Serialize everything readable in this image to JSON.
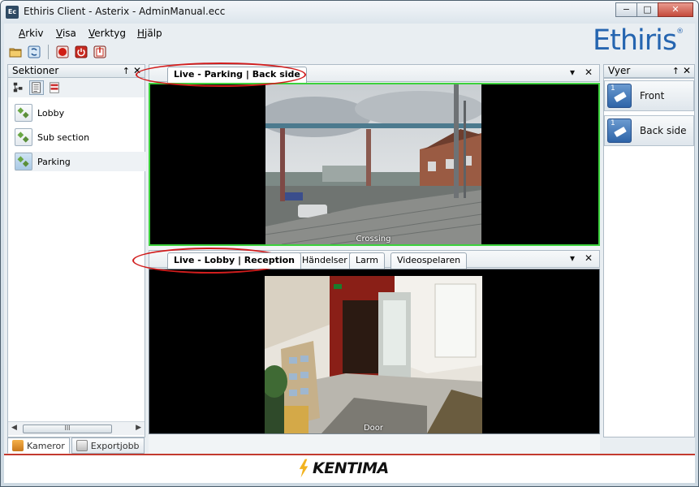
{
  "window": {
    "title": "Ethiris Client - Asterix - AdminManual.ecc",
    "app_icon_text": "Ec",
    "minimize": "−",
    "maximize": "□",
    "close": "✕"
  },
  "menu": {
    "items": [
      "Arkiv",
      "Visa",
      "Verktyg",
      "Hjälp"
    ]
  },
  "toolbar": {
    "icons": [
      "folder-icon",
      "refresh-icon",
      "record-icon",
      "power-icon",
      "export-icon"
    ]
  },
  "logo": {
    "text": "Ethiris",
    "mark": "®"
  },
  "sections_panel": {
    "title": "Sektioner",
    "pin": "↑",
    "close": "✕",
    "items": [
      {
        "label": "Lobby",
        "selected": false
      },
      {
        "label": "Sub section",
        "selected": false
      },
      {
        "label": "Parking",
        "selected": true
      }
    ],
    "scroll_thumb": "III",
    "bottom_tabs": [
      {
        "label": "Kameror",
        "active": true
      },
      {
        "label": "Exportjobb",
        "active": false
      }
    ]
  },
  "top_group": {
    "tabs": [
      {
        "label": "Live - Parking | Back side",
        "active": true
      }
    ],
    "dropdown": "▾",
    "close": "✕",
    "camera_label": "Crossing",
    "accent": "#3cd13c"
  },
  "bottom_group": {
    "tabs": [
      {
        "label": "Live - Lobby | Reception",
        "active": true
      },
      {
        "label": "Händelser",
        "active": false
      },
      {
        "label": "Larm",
        "active": false
      },
      {
        "label": "Videospelaren",
        "active": false
      }
    ],
    "dropdown": "▾",
    "close": "✕",
    "camera_label": "Door"
  },
  "views_panel": {
    "title": "Vyer",
    "pin": "↑",
    "close": "✕",
    "items": [
      {
        "label": "Front",
        "num": "1"
      },
      {
        "label": "Back side",
        "num": "1"
      }
    ]
  },
  "footer": {
    "brand": "KENTIMA",
    "accent": "#c33a2f"
  },
  "annotation_color": "#d11d1d"
}
